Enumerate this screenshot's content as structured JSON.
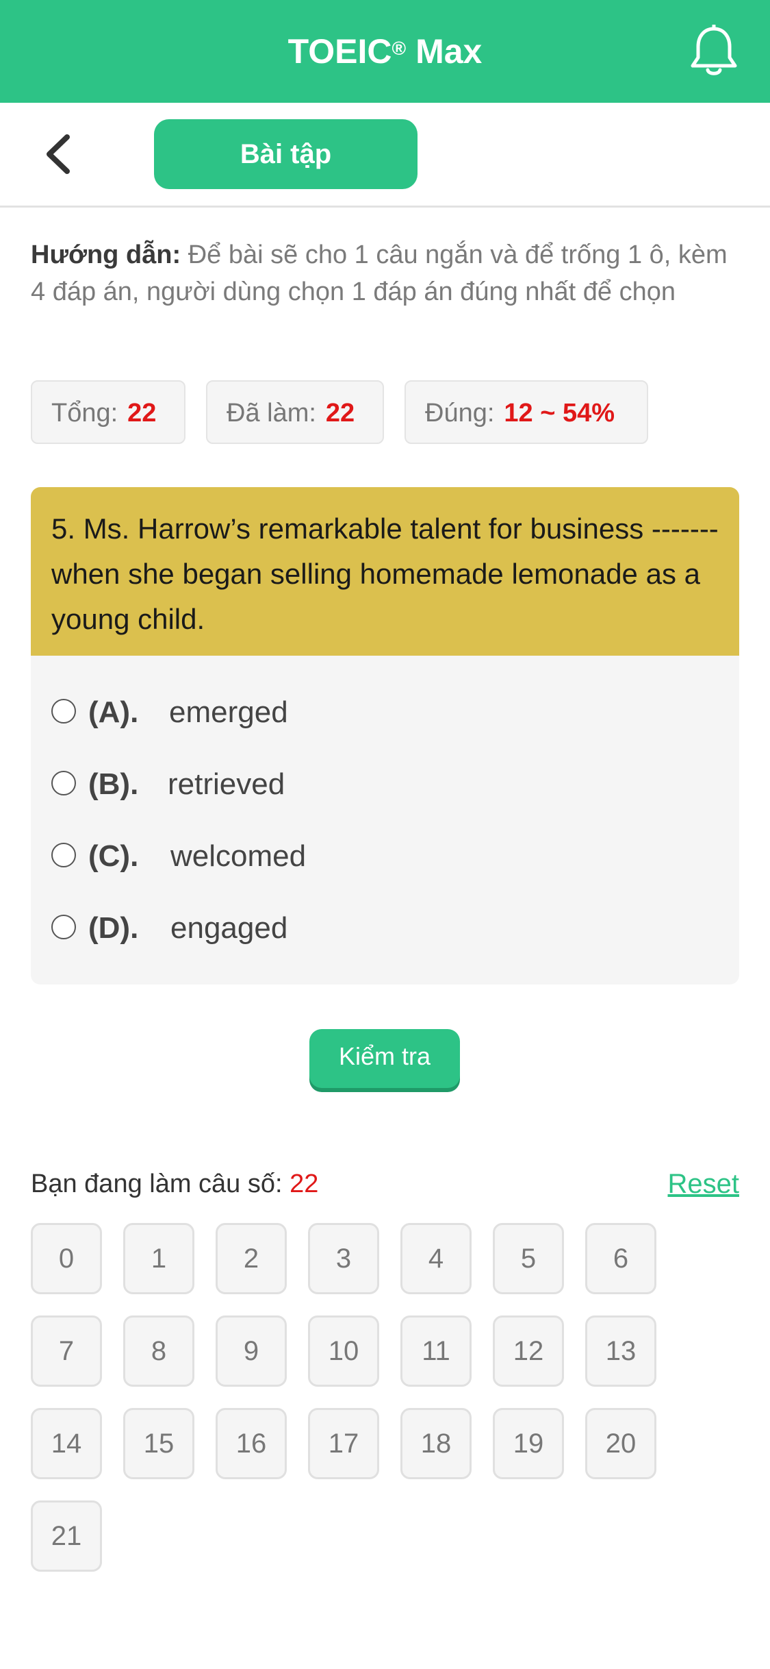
{
  "header": {
    "title": "TOEIC",
    "title_sup": "®",
    "title_suffix": " Max",
    "bell_icon": "bell-icon"
  },
  "subbar": {
    "back_icon": "chevron-left-icon",
    "tab_label": "Bài tập"
  },
  "guide": {
    "label": "Hướng dẫn:",
    "text": " Để bài sẽ cho 1 câu ngắn và để trống 1 ô, kèm 4 đáp án, người dùng chọn 1 đáp án đúng nhất để chọn"
  },
  "stats": [
    {
      "label": "Tổng:",
      "value": "22"
    },
    {
      "label": "Đã làm:",
      "value": "22"
    },
    {
      "label": "Đúng:",
      "value": "12 ~ 54%"
    }
  ],
  "question": {
    "text": "5. Ms. Harrow’s remarkable talent for business ------- when she began selling homemade lemonade as a young child.",
    "options": [
      {
        "label": "(A).",
        "text": "emerged"
      },
      {
        "label": "(B).",
        "text": "retrieved"
      },
      {
        "label": "(C).",
        "text": "welcomed"
      },
      {
        "label": "(D).",
        "text": "engaged"
      }
    ]
  },
  "check_button": "Kiểm tra",
  "progress": {
    "label": "Bạn đang làm câu số:",
    "value": "22",
    "reset": "Reset"
  },
  "numbers": [
    "0",
    "1",
    "2",
    "3",
    "4",
    "5",
    "6",
    "7",
    "8",
    "9",
    "10",
    "11",
    "12",
    "13",
    "14",
    "15",
    "16",
    "17",
    "18",
    "19",
    "20",
    "21"
  ],
  "colors": {
    "accent": "#2dc386",
    "question_bg": "#dbc04e",
    "highlight": "#e01818"
  }
}
